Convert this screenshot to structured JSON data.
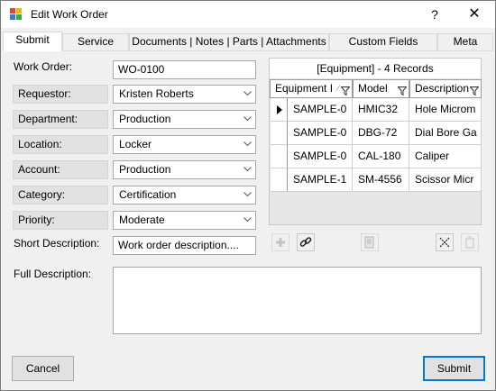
{
  "window": {
    "title": "Edit Work Order",
    "help": "?",
    "close": "✕"
  },
  "tabs": [
    {
      "label": "Submit"
    },
    {
      "label": "Service"
    },
    {
      "label": "Documents | Notes | Parts | Attachments"
    },
    {
      "label": "Custom Fields"
    },
    {
      "label": "Meta"
    }
  ],
  "form": {
    "work_order_label": "Work Order:",
    "work_order_value": "WO-0100",
    "requestor_label": "Requestor:",
    "requestor_value": "Kristen Roberts",
    "department_label": "Department:",
    "department_value": "Production",
    "location_label": "Location:",
    "location_value": "Locker",
    "account_label": "Account:",
    "account_value": "Production",
    "category_label": "Category:",
    "category_value": "Certification",
    "priority_label": "Priority:",
    "priority_value": "Moderate",
    "short_desc_label": "Short Description:",
    "short_desc_value": "Work order description....",
    "full_desc_label": "Full Description:",
    "full_desc_value": ""
  },
  "equipment": {
    "caption": "[Equipment] - 4 Records",
    "columns": [
      "Equipment I",
      "Model",
      "Description"
    ],
    "rows": [
      [
        "SAMPLE-0",
        "HMIC32",
        "Hole Microm"
      ],
      [
        "SAMPLE-0",
        "DBG-72",
        "Dial Bore Ga"
      ],
      [
        "SAMPLE-0",
        "CAL-180",
        "Caliper"
      ],
      [
        "SAMPLE-1",
        "SM-4556",
        "Scissor Micr"
      ]
    ]
  },
  "buttons": {
    "cancel": "Cancel",
    "submit": "Submit"
  },
  "colors": {
    "accent": "#0078d7",
    "label_bg": "#e1e1e1",
    "window_bg": "#f0f0f0"
  }
}
